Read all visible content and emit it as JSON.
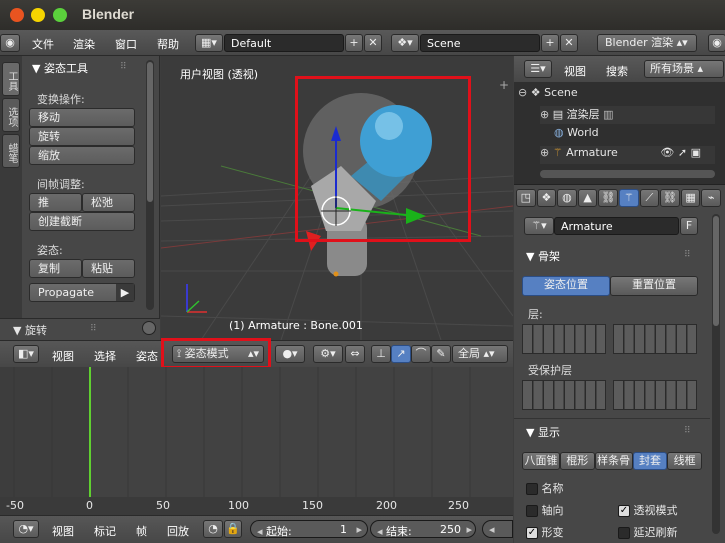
{
  "app": {
    "title": "Blender"
  },
  "topmenu": {
    "file": "文件",
    "render": "渲染",
    "window": "窗口",
    "help": "帮助",
    "layout": "Default",
    "scene": "Scene",
    "engine": "Blender 渲染"
  },
  "tools": {
    "tabs": [
      "工具",
      "选项",
      "蜡笔"
    ],
    "header": "▼ 姿态工具",
    "transform_label": "变换操作:",
    "move": "移动",
    "rotate": "旋转",
    "scale": "缩放",
    "inbetween_label": "间帧调整:",
    "push": "推",
    "relax": "松弛",
    "breakdown": "创建截断",
    "pose_label": "姿态:",
    "copy": "复制",
    "paste": "粘贴",
    "propagate": "Propagate"
  },
  "rotate_panel": {
    "label": "▼ 旋转"
  },
  "viewport": {
    "view_label": "用户视图 (透视)",
    "object_info": "(1) Armature : Bone.001"
  },
  "header3d": {
    "view": "视图",
    "select": "选择",
    "pose": "姿态",
    "mode": "姿态模式",
    "global": "全局"
  },
  "timeline": {
    "ticks": [
      "-50",
      "0",
      "50",
      "100",
      "150",
      "200",
      "250"
    ],
    "current_frame": 1
  },
  "timelinebar": {
    "view": "视图",
    "marker": "标记",
    "frame": "帧",
    "playback": "回放",
    "start_label": "起始:",
    "start": "1",
    "end_label": "结束:",
    "end": "250"
  },
  "outliner": {
    "view": "视图",
    "search": "搜索",
    "filter": "所有场景",
    "items": [
      "Scene",
      "渲染层",
      "World",
      "Armature"
    ]
  },
  "props": {
    "object": "Armature",
    "f": "F",
    "skeleton": "▼ 骨架",
    "pose_position": "姿态位置",
    "rest_position": "重置位置",
    "layers": "层:",
    "protected": "受保护层",
    "display": "▼ 显示",
    "display_types": [
      "八面锥",
      "棍形",
      "样条骨",
      "封套",
      "线框"
    ],
    "names": "名称",
    "axes": "轴向",
    "shape": "形变",
    "xray": "透视模式",
    "delay": "延迟刷新"
  },
  "colors": {
    "highlight": "#e0101a",
    "accent": "#5680c2"
  }
}
